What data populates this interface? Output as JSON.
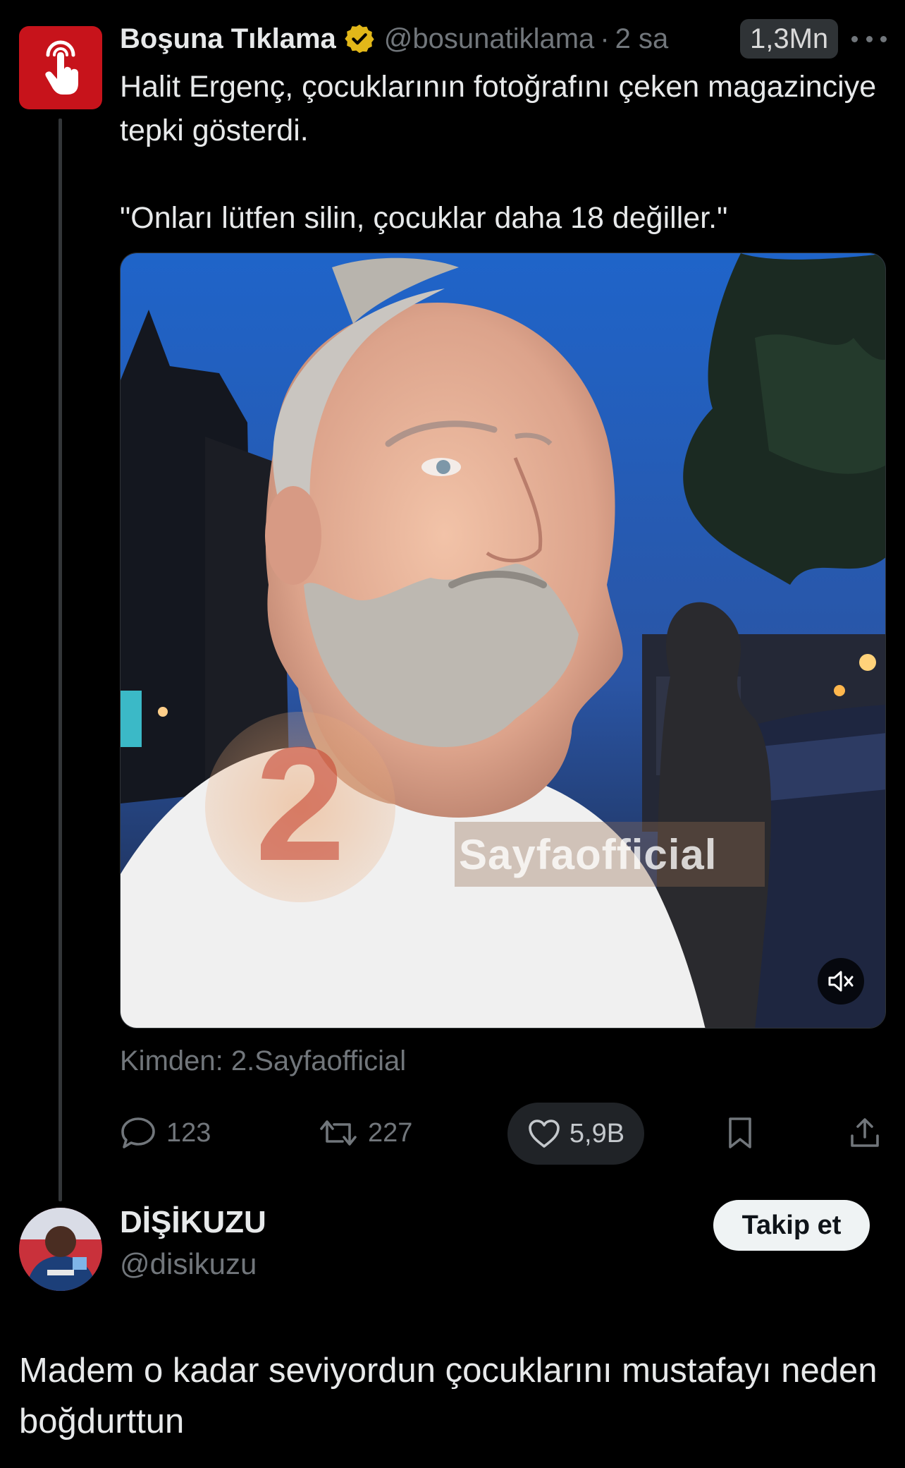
{
  "tweet": {
    "author_name": "Boşuna Tıklama",
    "handle": "@bosunatiklama",
    "separator": "·",
    "time": "2 sa",
    "views": "1,3Mn",
    "text_line1": "Halit Ergenç, çocuklarının fotoğrafını çeken magazinciye tepki gösterdi.",
    "text_line2": "\"Onları lütfen silin, çocuklar daha 18 değiller.\"",
    "media": {
      "watermark_digit": "2",
      "watermark_text": "Sayfaofficial"
    },
    "source": "Kimden: 2.Sayfaofficial",
    "actions": {
      "replies": "123",
      "retweets": "227",
      "likes": "5,9B"
    }
  },
  "reply": {
    "author_name": "DİŞİKUZU",
    "handle": "@disikuzu",
    "follow_label": "Takip et",
    "text": "Madem o kadar seviyordun çocuklarını mustafayı neden boğdurttun"
  },
  "colors": {
    "background": "#000000",
    "text_primary": "#e7e9ea",
    "text_secondary": "#71767b",
    "brand_red": "#c7131b",
    "verified_gold": "#e2b719",
    "follow_button_bg": "#eff3f4"
  },
  "icons": [
    "touch-hand-icon",
    "verified-badge-icon",
    "more-icon",
    "mute-icon",
    "reply-icon",
    "retweet-icon",
    "heart-icon",
    "bookmark-icon",
    "share-icon"
  ]
}
